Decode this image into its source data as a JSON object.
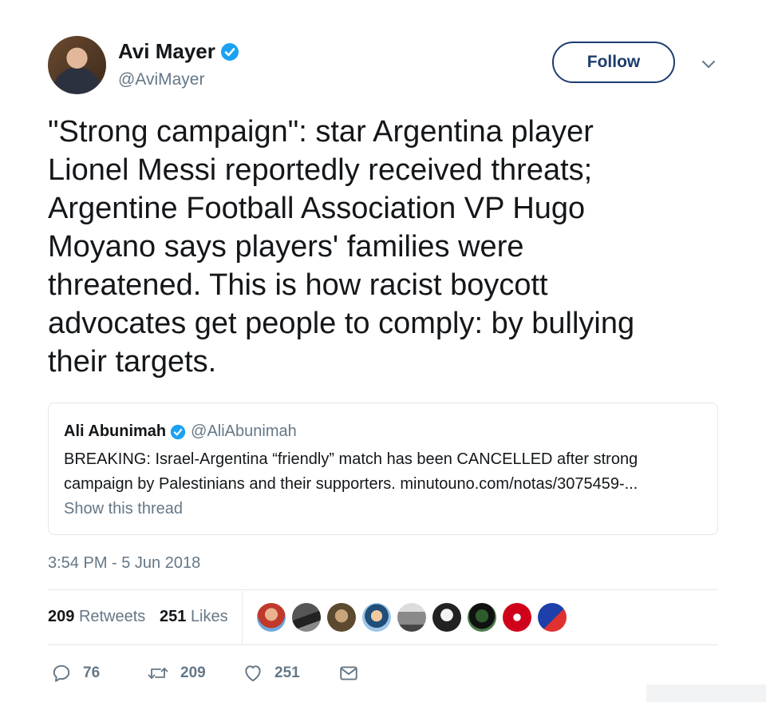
{
  "author": {
    "name": "Avi Mayer",
    "handle": "@AviMayer"
  },
  "follow_label": "Follow",
  "tweet_text": "\"Strong campaign\": star Argentina player\nLionel Messi reportedly received threats;\nArgentine Football Association VP Hugo\nMoyano says players' families were\nthreatened. This is how racist boycott\nadvocates get people to comply: by bullying\ntheir targets.",
  "quoted": {
    "name": "Ali Abunimah",
    "handle": "@AliAbunimah",
    "text": "BREAKING: Israel-Argentina “friendly” match has been CANCELLED after strong campaign by Palestinians and their supporters.  minutouno.com/notas/3075459-...",
    "show_thread": "Show this thread"
  },
  "timestamp": "3:54 PM - 5 Jun 2018",
  "stats": {
    "retweets_count": "209",
    "retweets_label": "Retweets",
    "likes_count": "251",
    "likes_label": "Likes"
  },
  "actions": {
    "replies": "76",
    "retweets": "209",
    "likes": "251"
  },
  "colors": {
    "verified": "#1da1f2",
    "follow_border": "#1d3c6e",
    "secondary_text": "#657786"
  },
  "icons": [
    "verified-badge-icon",
    "chevron-down-icon",
    "reply-icon",
    "retweet-icon",
    "heart-icon",
    "message-icon"
  ]
}
